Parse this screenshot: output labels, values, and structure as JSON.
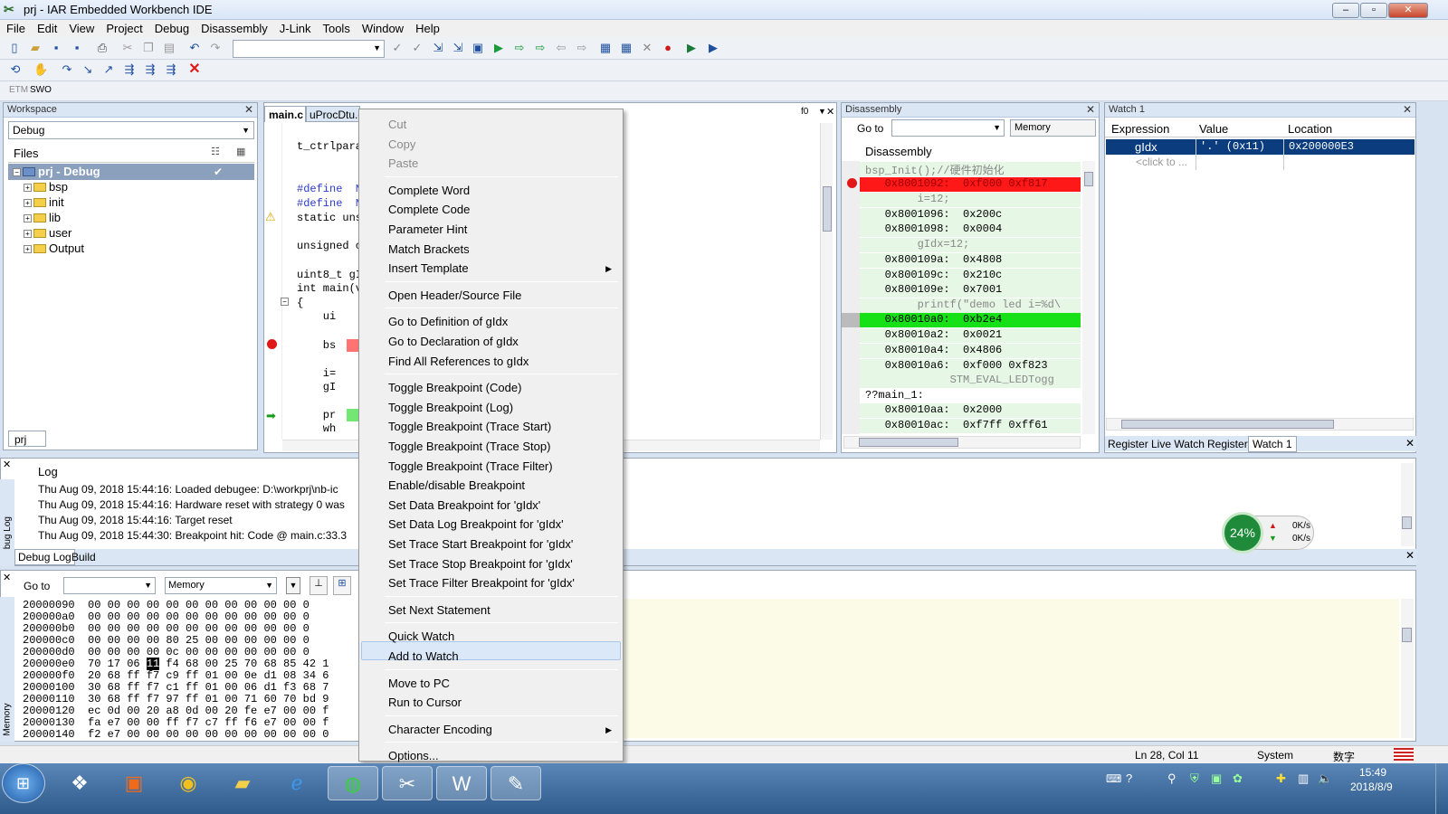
{
  "window": {
    "title": "prj - IAR Embedded Workbench IDE",
    "min": "–",
    "max": "▫",
    "close": "✕"
  },
  "menu": [
    "File",
    "Edit",
    "View",
    "Project",
    "Debug",
    "Disassembly",
    "J-Link",
    "Tools",
    "Window",
    "Help"
  ],
  "toolbar3": {
    "etm": "ETM",
    "swo": "SWO"
  },
  "workspace": {
    "title": "Workspace",
    "config": "Debug",
    "files_header": "Files",
    "root": "prj - Debug",
    "items": [
      "bsp",
      "init",
      "lib",
      "user",
      "Output"
    ],
    "tab": "prj"
  },
  "editor": {
    "tabs": [
      "main.c",
      "uProcDtu.c"
    ],
    "tab_right": "f0",
    "lines": [
      {
        "t": "t_ctrlpara",
        "kind": "normal"
      },
      {
        "t": "#define  N",
        "kind": "blue"
      },
      {
        "t": "#define  N",
        "kind": "blue"
      },
      {
        "t": "static uns",
        "kind": "normal"
      },
      {
        "t": "unsigned c",
        "kind": "normal"
      },
      {
        "t": "uint8_t gI",
        "kind": "normal"
      },
      {
        "t": "int main(v",
        "kind": "normal"
      },
      {
        "t": "{",
        "kind": "normal"
      },
      {
        "t": "    ui",
        "kind": "normal"
      },
      {
        "t": "    bs",
        "kind": "bp"
      },
      {
        "t": "    i=",
        "kind": "normal"
      },
      {
        "t": "    gI",
        "kind": "normal"
      },
      {
        "t": "    pr",
        "kind": "pc"
      },
      {
        "t": "    wh",
        "kind": "normal"
      }
    ]
  },
  "disassembly": {
    "title": "Disassembly",
    "goto_label": "Go to",
    "memory_label": "Memory",
    "header": "Disassembly",
    "lines": [
      {
        "t": "bsp_Init();//硬件初始化",
        "kind": "src"
      },
      {
        "t": "   0x8001092:  0xf000 0xf817",
        "kind": "bp"
      },
      {
        "t": "        i=12;",
        "kind": "src"
      },
      {
        "t": "   0x8001096:  0x200c",
        "kind": "code"
      },
      {
        "t": "   0x8001098:  0x0004",
        "kind": "code"
      },
      {
        "t": "        gIdx=12;",
        "kind": "src"
      },
      {
        "t": "   0x800109a:  0x4808",
        "kind": "code"
      },
      {
        "t": "   0x800109c:  0x210c",
        "kind": "code"
      },
      {
        "t": "   0x800109e:  0x7001",
        "kind": "code"
      },
      {
        "t": "        printf(\"demo led i=%d\\",
        "kind": "src"
      },
      {
        "t": "   0x80010a0:  0xb2e4",
        "kind": "pc"
      },
      {
        "t": "   0x80010a2:  0x0021",
        "kind": "code"
      },
      {
        "t": "   0x80010a4:  0x4806",
        "kind": "code"
      },
      {
        "t": "   0x80010a6:  0xf000 0xf823",
        "kind": "code"
      },
      {
        "t": "             STM_EVAL_LEDTogg",
        "kind": "src"
      },
      {
        "t": "??main_1:",
        "kind": "label"
      },
      {
        "t": "   0x80010aa:  0x2000",
        "kind": "code"
      },
      {
        "t": "   0x80010ac:  0xf7ff 0xff61",
        "kind": "code"
      }
    ]
  },
  "watch": {
    "title": "Watch 1",
    "columns": [
      "Expression",
      "Value",
      "Location"
    ],
    "rows": [
      {
        "expr": "gIdx",
        "value": "'.' (0x11)",
        "loc": "0x200000E3"
      }
    ],
    "placeholder": "<click to ...",
    "tabs": [
      "Register",
      "Live Watch",
      "Register",
      "Watch 1"
    ]
  },
  "log": {
    "header": "Log",
    "side_label": "Debug Log",
    "lines": [
      "Thu Aug 09, 2018 15:44:16: Loaded debugee: D:\\workprj\\nb-ic",
      "Thu Aug 09, 2018 15:44:16: Hardware reset with strategy 0 was",
      "Thu Aug 09, 2018 15:44:16: Target reset",
      "Thu Aug 09, 2018 15:44:30: Breakpoint hit: Code @ main.c:33.3"
    ],
    "tabs": [
      "Debug Log",
      "Build"
    ]
  },
  "netmeter": {
    "percent": "24%",
    "up": "0K/s",
    "down": "0K/s"
  },
  "memory": {
    "side_label": "Memory",
    "goto_label": "Go to",
    "zone": "Memory",
    "rows": [
      {
        "addr": "20000090",
        "bytes": "00 00 00 00 00 00 00 00 00 00 00 0"
      },
      {
        "addr": "200000a0",
        "bytes": "00 00 00 00 00 00 00 00 00 00 00 0"
      },
      {
        "addr": "200000b0",
        "bytes": "00 00 00 00 00 00 00 00 00 00 00 0"
      },
      {
        "addr": "200000c0",
        "bytes": "00 00 00 00 80 25 00 00 00 00 00 0"
      },
      {
        "addr": "200000d0",
        "bytes": "00 00 00 00 0c 00 00 00 00 00 00 0"
      },
      {
        "addr": "200000e0",
        "bytes_pre": "70 17 06 ",
        "sel": "11",
        "bytes_post": " f4 68 00 25 70 68 85 42 1"
      },
      {
        "addr": "200000f0",
        "bytes": "20 68 ff f7 c9 ff 01 00 0e d1 08 34 6"
      },
      {
        "addr": "20000100",
        "bytes": "30 68 ff f7 c1 ff 01 00 06 d1 f3 68 7"
      },
      {
        "addr": "20000110",
        "bytes": "30 68 ff f7 97 ff 01 00 71 60 70 bd 9"
      },
      {
        "addr": "20000120",
        "bytes": "ec 0d 00 20 a8 0d 00 20 fe e7 00 00 f"
      },
      {
        "addr": "20000130",
        "bytes": "fa e7 00 00 ff f7 c7 ff f6 e7 00 00 f"
      },
      {
        "addr": "20000140",
        "bytes": "f2 e7 00 00 00 00 00 00 00 00 00 00 0"
      }
    ]
  },
  "context_menu": {
    "groups": [
      [
        {
          "label": "Cut",
          "disabled": true
        },
        {
          "label": "Copy",
          "disabled": true
        },
        {
          "label": "Paste",
          "disabled": true
        }
      ],
      [
        {
          "label": "Complete Word"
        },
        {
          "label": "Complete Code"
        },
        {
          "label": "Parameter Hint"
        },
        {
          "label": "Match Brackets"
        },
        {
          "label": "Insert Template",
          "submenu": true
        }
      ],
      [
        {
          "label": "Open Header/Source File"
        }
      ],
      [
        {
          "label": "Go to Definition of gIdx"
        },
        {
          "label": "Go to Declaration of gIdx"
        },
        {
          "label": "Find All References to gIdx"
        }
      ],
      [
        {
          "label": "Toggle Breakpoint (Code)"
        },
        {
          "label": "Toggle Breakpoint (Log)"
        },
        {
          "label": "Toggle Breakpoint (Trace Start)"
        },
        {
          "label": "Toggle Breakpoint (Trace Stop)"
        },
        {
          "label": "Toggle Breakpoint (Trace Filter)"
        },
        {
          "label": "Enable/disable Breakpoint"
        },
        {
          "label": "Set Data Breakpoint for 'gIdx'"
        },
        {
          "label": "Set Data Log Breakpoint for 'gIdx'"
        },
        {
          "label": "Set Trace Start Breakpoint for 'gIdx'"
        },
        {
          "label": "Set Trace Stop Breakpoint for 'gIdx'"
        },
        {
          "label": "Set Trace Filter Breakpoint for 'gIdx'"
        }
      ],
      [
        {
          "label": "Set Next Statement"
        }
      ],
      [
        {
          "label": "Quick Watch"
        },
        {
          "label": "Add to Watch",
          "highlighted": true
        }
      ],
      [
        {
          "label": "Move to PC"
        },
        {
          "label": "Run to Cursor"
        }
      ],
      [
        {
          "label": "Character Encoding",
          "submenu": true
        }
      ],
      [
        {
          "label": "Options..."
        }
      ]
    ]
  },
  "statusbar": {
    "position": "Ln 28, Col 11",
    "encoding": "System",
    "ime": "数字"
  },
  "taskbar": {
    "clock_time": "15:49",
    "clock_date": "2018/8/9",
    "apps": [
      "start",
      "app-1",
      "pdf",
      "browser",
      "explorer",
      "ie",
      "app-6",
      "iar",
      "app-8",
      "app-9"
    ]
  },
  "colors": {
    "breakpoint": "#ff2020",
    "pc": "#22ee22",
    "selection": "#0a3c7e",
    "menu_highlight": "#dbe8f8"
  }
}
